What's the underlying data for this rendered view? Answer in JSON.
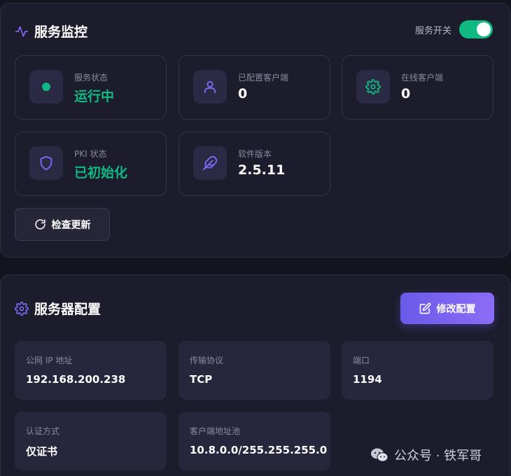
{
  "monitor": {
    "title": "服务监控",
    "toggle": {
      "label": "服务开关",
      "on": true
    },
    "stats": {
      "service_status": {
        "label": "服务状态",
        "value": "运行中"
      },
      "configured_clients": {
        "label": "已配置客户端",
        "value": "0"
      },
      "online_clients": {
        "label": "在线客户端",
        "value": "0"
      },
      "pki_status": {
        "label": "PKI 状态",
        "value": "已初始化"
      },
      "software_version": {
        "label": "软件版本",
        "value": "2.5.11"
      }
    },
    "check_update_label": "检查更新"
  },
  "config": {
    "title": "服务器配置",
    "edit_label": "修改配置",
    "fields": {
      "public_ip": {
        "label": "公网 IP 地址",
        "value": "192.168.200.238"
      },
      "protocol": {
        "label": "传输协议",
        "value": "TCP"
      },
      "port": {
        "label": "端口",
        "value": "1194"
      },
      "auth_method": {
        "label": "认证方式",
        "value": "仅证书"
      },
      "client_pool": {
        "label": "客户端地址池",
        "value": "10.8.0.0/255.255.255.0"
      }
    }
  },
  "watermark": {
    "text": "公众号 · 铁军哥"
  },
  "colors": {
    "accent": "#7c6cf5",
    "success": "#10b981",
    "panel": "#1c1c2c",
    "background": "#14141f"
  }
}
